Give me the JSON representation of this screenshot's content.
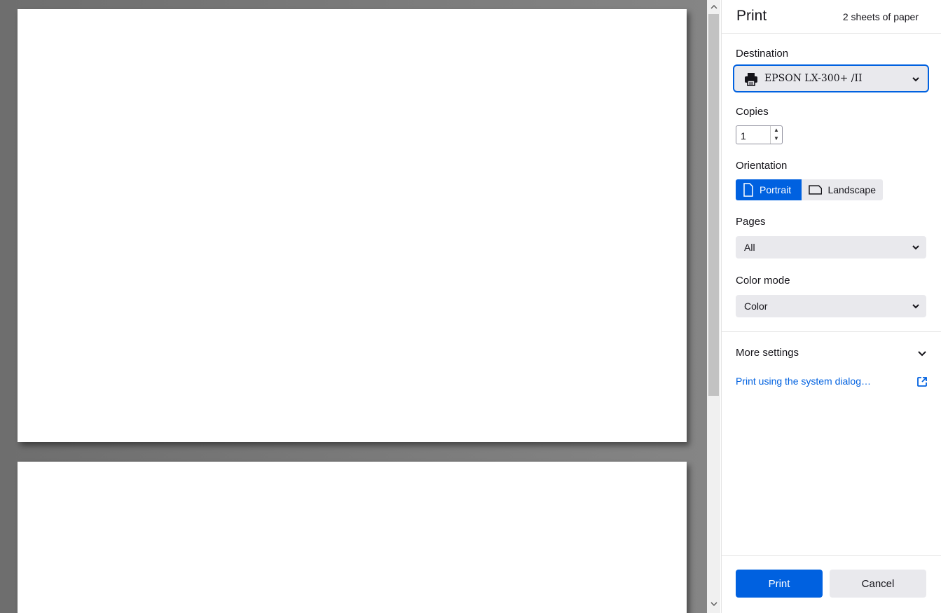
{
  "header": {
    "title": "Print",
    "sheets": "2 sheets of paper"
  },
  "destination": {
    "label": "Destination",
    "value": "EPSON LX-300+ /II",
    "icon": "printer-icon"
  },
  "copies": {
    "label": "Copies",
    "value": "1"
  },
  "orientation": {
    "label": "Orientation",
    "options": [
      "Portrait",
      "Landscape"
    ],
    "selected": "Portrait"
  },
  "pages": {
    "label": "Pages",
    "value": "All"
  },
  "color_mode": {
    "label": "Color mode",
    "value": "Color"
  },
  "more_settings": {
    "label": "More settings"
  },
  "system_dialog": {
    "label": "Print using the system dialog…"
  },
  "actions": {
    "print_label": "Print",
    "cancel_label": "Cancel"
  },
  "colors": {
    "accent": "#0061e0",
    "button_bg": "#e9e9ed",
    "preview_bg": "#7a7a7a"
  }
}
